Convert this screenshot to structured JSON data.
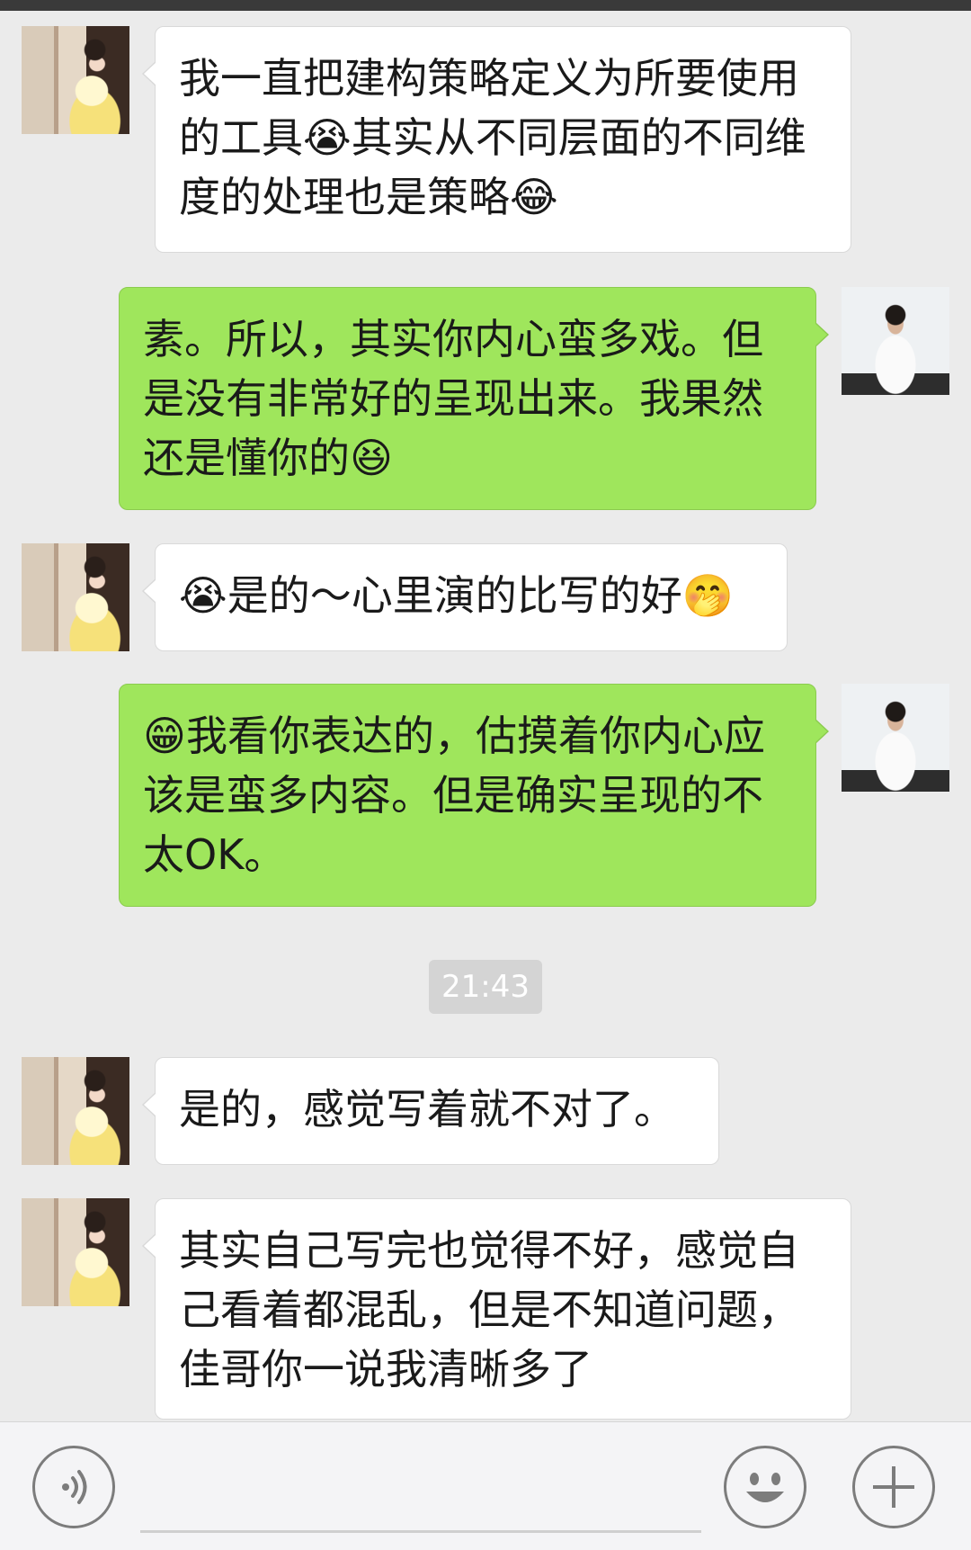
{
  "messages": [
    {
      "sender": "other",
      "text": "我一直把建构策略定义为所要使用的工具😭其实从不同层面的不同维度的处理也是策略😂"
    },
    {
      "sender": "self",
      "text": "素。所以，其实你内心蛮多戏。但是没有非常好的呈现出来。我果然还是懂你的😆"
    },
    {
      "sender": "other",
      "text": "😭是的～心里演的比写的好🤭"
    },
    {
      "sender": "self",
      "text": "😁我看你表达的，估摸着你内心应该是蛮多内容。但是确实呈现的不太OK。"
    },
    {
      "sender": "other",
      "text": "是的，感觉写着就不对了。"
    },
    {
      "sender": "other",
      "text": "其实自己写完也觉得不好，感觉自己看着都混乱，但是不知道问题，佳哥你一说我清晰多了"
    }
  ],
  "timestamp": "21:43",
  "toolbar": {
    "voice_icon": "voice-icon",
    "emoji_icon": "emoji-icon",
    "plus_icon": "plus-icon"
  },
  "colors": {
    "self_bubble": "#9fe65c",
    "other_bubble": "#ffffff",
    "background": "#ebebeb"
  }
}
